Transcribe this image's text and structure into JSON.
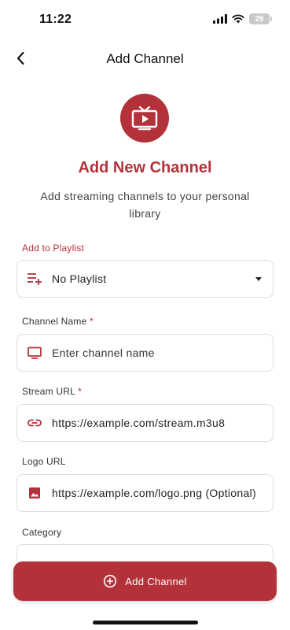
{
  "status_bar": {
    "time": "11:22",
    "battery": "29"
  },
  "app_bar": {
    "title": "Add Channel"
  },
  "hero": {
    "title": "Add New Channel",
    "subtitle": "Add streaming channels to your personal library"
  },
  "form": {
    "playlist": {
      "label": "Add to Playlist",
      "value": "No Playlist"
    },
    "channel_name": {
      "label": "Channel Name",
      "required_mark": "*",
      "placeholder": "Enter channel name"
    },
    "stream_url": {
      "label": "Stream URL",
      "required_mark": "*",
      "placeholder": "https://example.com/stream.m3u8"
    },
    "logo_url": {
      "label": "Logo URL",
      "placeholder": "https://example.com/logo.png (Optional)"
    },
    "category": {
      "label": "Category"
    }
  },
  "actions": {
    "add_label": "Add Channel"
  },
  "colors": {
    "accent": "#b3323a",
    "border": "#dedede"
  },
  "icons": [
    "back-icon",
    "tv-play-icon",
    "playlist-add-icon",
    "dropdown-caret-icon",
    "monitor-icon",
    "link-icon",
    "image-icon",
    "add-circle-icon"
  ]
}
